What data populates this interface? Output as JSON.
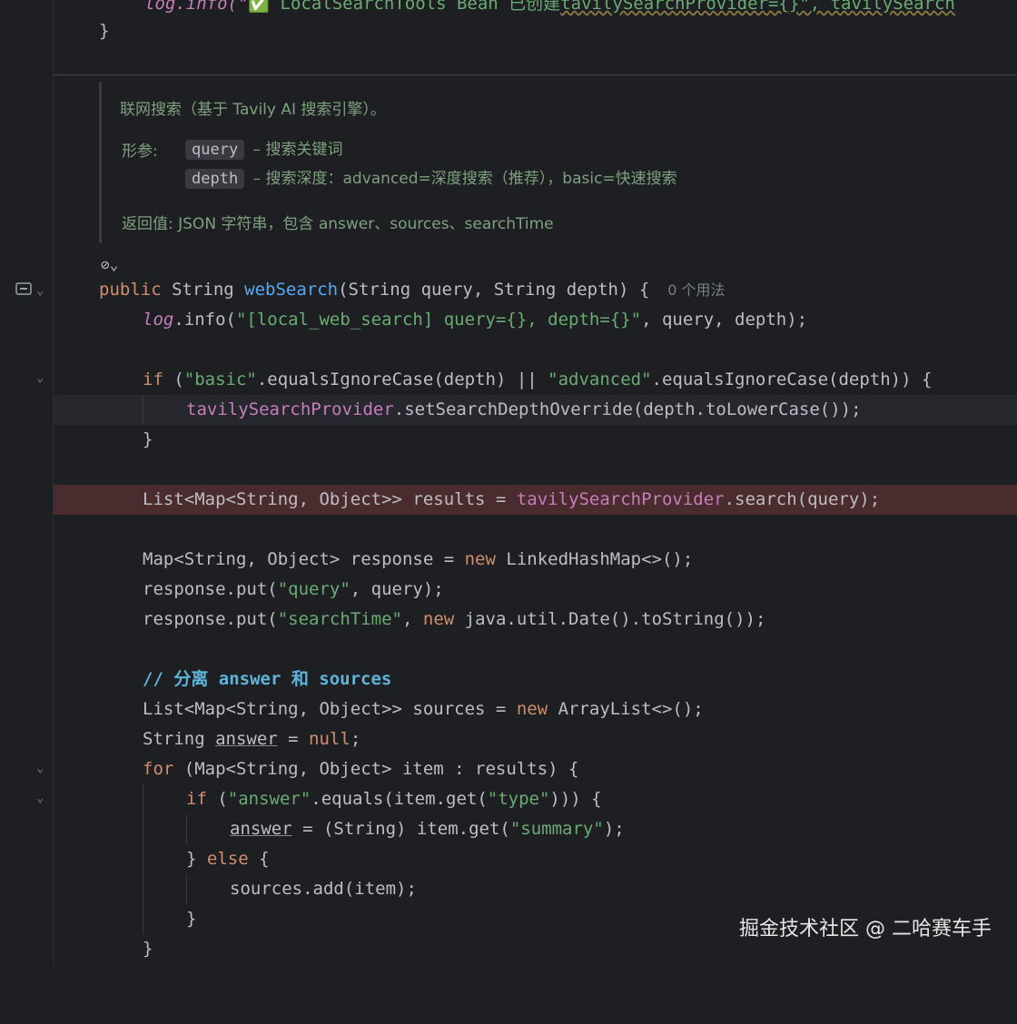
{
  "top": {
    "line1_code": "log.info(\"",
    "line1_check": "✅",
    "line1_text": " LocalSearchTools Bean ",
    "line1_cn": "已创建",
    "line1_rest": "tavilySearchProvider={}\", tavilySearch",
    "line2": "}"
  },
  "doc": {
    "summary": "联网搜索（基于 Tavily AI 搜索引擎）。",
    "params_label": "形参:",
    "p1_name": "query",
    "p1_desc": " – 搜索关键词",
    "p2_name": "depth",
    "p2_desc": " – 搜索深度：advanced=深度搜索（推荐），basic=快速搜索",
    "returns": "返回值: JSON 字符串，包含 answer、sources、searchTime"
  },
  "code": {
    "public": "public",
    "string_type": " String ",
    "method_name": "webSearch",
    "sig_rest": "(String query, String depth) {",
    "usages": "0 个用法",
    "log": "log",
    "log_rest": ".info(",
    "log_str": "\"[local_web_search] query={}, depth={}\"",
    "log_args": ", query, depth);",
    "if": "if",
    "if_open": " (",
    "basic": "\"basic\"",
    "eq1": ".equalsIgnoreCase(depth) || ",
    "advanced": "\"advanced\"",
    "eq2": ".equalsIgnoreCase(depth)) {",
    "provider": "tavilySearchProvider",
    "setdepth": ".setSearchDepthOverride(depth.toLowerCase());",
    "close": "}",
    "list_decl": "List<Map<String, Object>> results = ",
    "search_call": ".search(query);",
    "map_decl": "Map<String, Object> response = ",
    "new": "new",
    "linked": " LinkedHashMap<>();",
    "put1": "response.put(",
    "query_str": "\"query\"",
    "put1_rest": ", query);",
    "searchtime_str": "\"searchTime\"",
    "put2_rest": ".util.Date().toString());",
    "java": " java",
    "comment": "// 分离 answer 和 sources",
    "sources_decl": "List<Map<String, Object>> sources = ",
    "arraylist": " ArrayList<>();",
    "string_answer": "String ",
    "answer": "answer",
    "eq_null": " = ",
    "null": "null",
    "semi": ";",
    "for": "for",
    "for_rest": " (Map<String, Object> item : results) {",
    "answer_str": "\"answer\"",
    "equals_get": ".equals(item.get(",
    "type_str": "\"type\"",
    "if2_end": "))) {",
    "assign_rest": " = (String) item.get(",
    "summary_str": "\"summary\"",
    "assign_end": ");",
    "else_open": "} ",
    "else": "else",
    "else_brace": " {",
    "sources_add": "sources.add(item);"
  },
  "watermark": "掘金技术社区 @ 二哈赛车手"
}
